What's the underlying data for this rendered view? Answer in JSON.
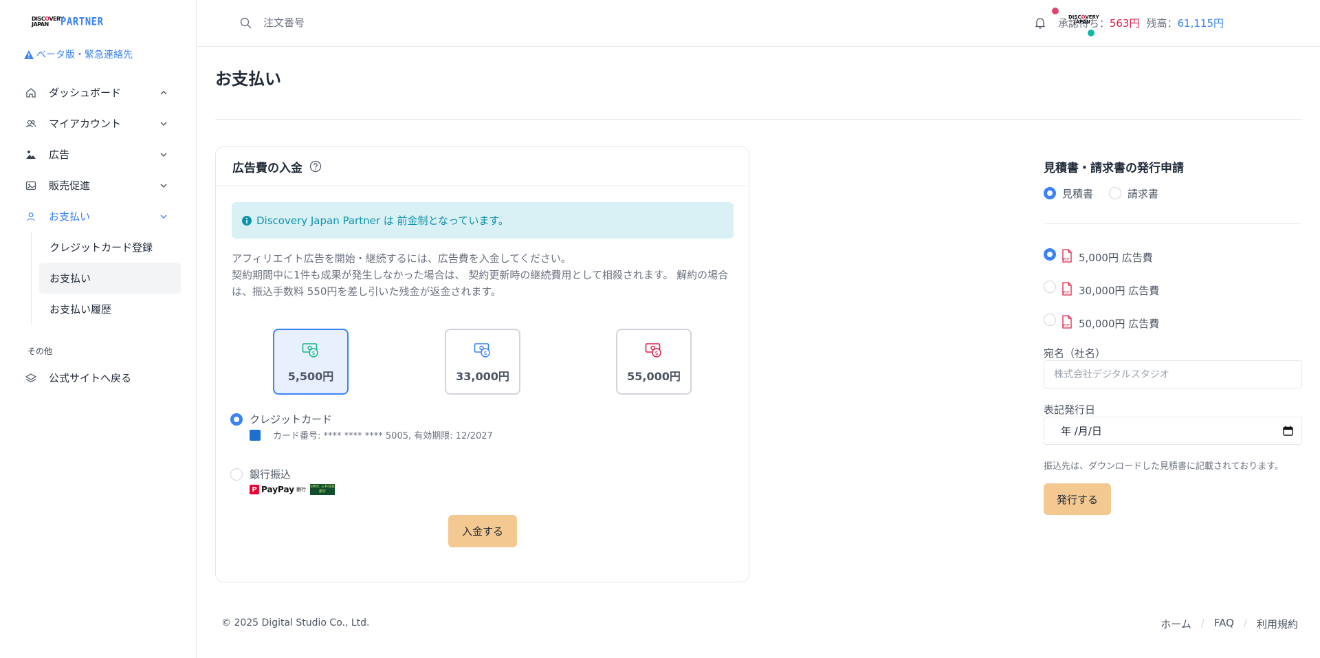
{
  "brand": {
    "logo_mark_line1": "DISC",
    "logo_mark_o": "O",
    "logo_mark_line1b": "VERY",
    "logo_mark_line2": "JAPAN",
    "logo_text": "PARTNER"
  },
  "sidebar": {
    "beta_link": "ベータ版・緊急連絡先",
    "items": [
      {
        "label": "ダッシュボード",
        "icon": "home-icon"
      },
      {
        "label": "マイアカウント",
        "icon": "users-icon"
      },
      {
        "label": "広告",
        "icon": "landscape-icon"
      },
      {
        "label": "販売促進",
        "icon": "image-icon"
      },
      {
        "label": "お支払い",
        "icon": "user-icon"
      }
    ],
    "payment_subitems": [
      {
        "label": "クレジットカード登録"
      },
      {
        "label": "お支払い"
      },
      {
        "label": "お支払い履歴"
      }
    ],
    "section_other": "その他",
    "back_link": "公式サイトへ戻る"
  },
  "topbar": {
    "search_placeholder": "注文番号",
    "pending_label": "承認待ち：",
    "pending_value": "563円",
    "balance_label": "残高：",
    "balance_value": "61,115円"
  },
  "page": {
    "title": "お支払い"
  },
  "deposit_card": {
    "title": "広告費の入金",
    "info_text": "Discovery Japan Partner は 前金制となっています。",
    "desc_line1": "アフィリエイト広告を開始・継続するには、広告費を入金してください。",
    "desc_line2": "契約期間中に1件も成果が発生しなかった場合は、 契約更新時の継続費用として相殺されます。 解約の場合は、振込手数料 550円を差し引いた残金が返金されます。",
    "amounts": [
      {
        "label": "5,500円",
        "color": "#10b981",
        "selected": true
      },
      {
        "label": "33,000円",
        "color": "#3b82f6",
        "selected": false
      },
      {
        "label": "55,000円",
        "color": "#e11d48",
        "selected": false
      }
    ],
    "payment_credit_label": "クレジットカード",
    "card_number_text": "カード番号: **** **** **** 5005, 有効期限: 12/2027",
    "payment_bank_label": "銀行振込",
    "paypay_text": "PayPay",
    "paypay_bank": "銀行",
    "smbc_text": "SMBC 三井住友銀行",
    "deposit_button": "入金する"
  },
  "right_panel": {
    "title": "見積書・請求書の発行申請",
    "doc_type_estimate": "見積書",
    "doc_type_invoice": "請求書",
    "options": [
      {
        "label": "5,000円 広告費",
        "selected": true
      },
      {
        "label": "30,000円 広告費",
        "selected": false
      },
      {
        "label": "50,000円 広告費",
        "selected": false
      }
    ],
    "addressee_label": "宛名（社名）",
    "addressee_placeholder": "株式会社デジタルスタジオ",
    "date_label": "表記発行日",
    "date_placeholder": "年 /月/日",
    "note": "振込先は、ダウンロードした見積書に記載されております。",
    "issue_button": "発行する"
  },
  "footer": {
    "copyright": "© 2025 Digital Studio Co., Ltd.",
    "links": [
      "ホーム",
      "FAQ",
      "利用規約"
    ]
  },
  "colors": {
    "accent_blue": "#3b82f6",
    "pending_red": "#e11d48",
    "button_orange": "#f3c891",
    "info_bg": "#d9f0f4"
  }
}
